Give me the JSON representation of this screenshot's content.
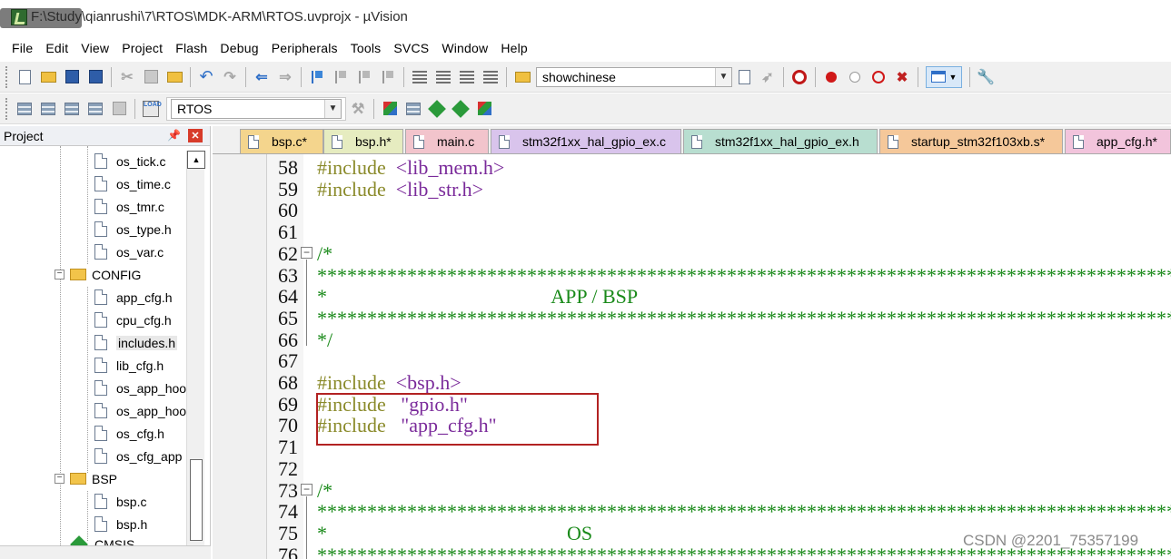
{
  "window": {
    "title": "F:\\Study\\qianrushi\\7\\RTOS\\MDK-ARM\\RTOS.uvprojx - µVision"
  },
  "menu": [
    "File",
    "Edit",
    "View",
    "Project",
    "Flash",
    "Debug",
    "Peripherals",
    "Tools",
    "SVCS",
    "Window",
    "Help"
  ],
  "toolbar": {
    "find_value": "showchinese",
    "target_value": "RTOS",
    "load_label": "LOAD"
  },
  "project_panel": {
    "title": "Project",
    "tree": [
      {
        "label": "os_tick.c",
        "type": "file"
      },
      {
        "label": "os_time.c",
        "type": "file"
      },
      {
        "label": "os_tmr.c",
        "type": "file"
      },
      {
        "label": "os_type.h",
        "type": "file"
      },
      {
        "label": "os_var.c",
        "type": "file"
      },
      {
        "label": "CONFIG",
        "type": "folder",
        "expanded": true
      },
      {
        "label": "app_cfg.h",
        "type": "file"
      },
      {
        "label": "cpu_cfg.h",
        "type": "file"
      },
      {
        "label": "includes.h",
        "type": "file",
        "selected": true
      },
      {
        "label": "lib_cfg.h",
        "type": "file"
      },
      {
        "label": "os_app_hoo",
        "type": "file"
      },
      {
        "label": "os_app_hoo",
        "type": "file"
      },
      {
        "label": "os_cfg.h",
        "type": "file"
      },
      {
        "label": "os_cfg_app",
        "type": "file"
      },
      {
        "label": "BSP",
        "type": "folder",
        "expanded": true
      },
      {
        "label": "bsp.c",
        "type": "file"
      },
      {
        "label": "bsp.h",
        "type": "file"
      },
      {
        "label": "CMSIS",
        "type": "folder"
      }
    ]
  },
  "tabs": [
    {
      "label": "bsp.c*",
      "color": "#f4d58d",
      "active": true
    },
    {
      "label": "bsp.h*",
      "color": "#e6ecc0"
    },
    {
      "label": "main.c",
      "color": "#f2c4cc"
    },
    {
      "label": "stm32f1xx_hal_gpio_ex.c",
      "color": "#d9c4ec"
    },
    {
      "label": "stm32f1xx_hal_gpio_ex.h",
      "color": "#b8ded0"
    },
    {
      "label": "startup_stm32f103xb.s*",
      "color": "#f5c89a"
    },
    {
      "label": "app_cfg.h*",
      "color": "#f2c4dc"
    }
  ],
  "code_lines": [
    {
      "n": "58",
      "kw": "#include",
      "arg": "<lib_mem.h>",
      "kind": "inc"
    },
    {
      "n": "59",
      "kw": "#include",
      "arg": "<lib_str.h>",
      "kind": "inc"
    },
    {
      "n": "60",
      "kind": "blank"
    },
    {
      "n": "61",
      "kind": "blank"
    },
    {
      "n": "62",
      "text": "/*",
      "kind": "cmt",
      "fold": true
    },
    {
      "n": "63",
      "text": "********************************************************************************************************",
      "kind": "cmt"
    },
    {
      "n": "64",
      "text": "*                                             APP / BSP",
      "kind": "cmt"
    },
    {
      "n": "65",
      "text": "********************************************************************************************************",
      "kind": "cmt"
    },
    {
      "n": "66",
      "text": "*/",
      "kind": "cmt"
    },
    {
      "n": "67",
      "kind": "blank"
    },
    {
      "n": "68",
      "kw": "#include",
      "arg": "<bsp.h>",
      "kind": "inc"
    },
    {
      "n": "69",
      "kw": "#include",
      "arg": " \"gpio.h\"",
      "kind": "inc"
    },
    {
      "n": "70",
      "kw": "#include",
      "arg": " \"app_cfg.h\"",
      "kind": "inc"
    },
    {
      "n": "71",
      "kind": "blank"
    },
    {
      "n": "72",
      "kind": "blank"
    },
    {
      "n": "73",
      "text": "/*",
      "kind": "cmt",
      "fold": true
    },
    {
      "n": "74",
      "text": "********************************************************************************************************",
      "kind": "cmt"
    },
    {
      "n": "75",
      "text": "*                                                OS",
      "kind": "cmt"
    },
    {
      "n": "76",
      "text": "********************************************************************************************************",
      "kind": "cmt"
    }
  ],
  "watermark": "CSDN @2201_75357199"
}
